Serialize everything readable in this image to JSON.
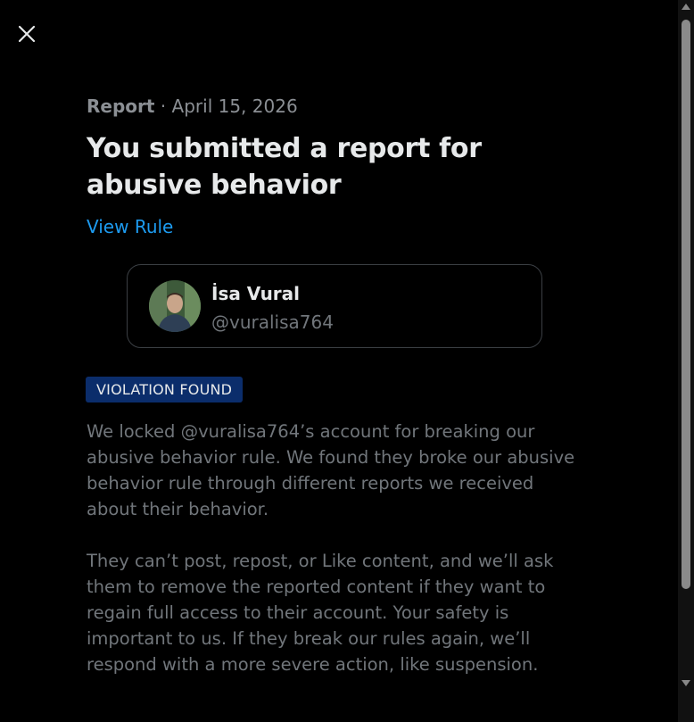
{
  "close": {
    "icon": "close-icon"
  },
  "report": {
    "kind": "Report",
    "separator": " · ",
    "date": "April 15, 2026",
    "title": "You submitted a report for abusive behavior",
    "view_rule_label": "View Rule"
  },
  "user": {
    "name": "İsa Vural",
    "handle": "@vuralisa764"
  },
  "badge": {
    "label": "VIOLATION FOUND",
    "color": "#0b2d6b"
  },
  "body": {
    "paragraph1": "We locked @vuralisa764’s account for breaking our abusive behavior rule. We found they broke our abusive behavior rule through different reports we received about their behavior.",
    "paragraph2": "They can’t post, repost, or Like content, and we’ll ask them to remove the reported content if they want to regain full access to their account. Your safety is important to us. If they break our rules again, we’ll respond with a more severe action, like suspension."
  },
  "colors": {
    "background": "#000000",
    "link": "#1d9bf0",
    "muted": "#71767b",
    "text": "#e7e9ea"
  }
}
